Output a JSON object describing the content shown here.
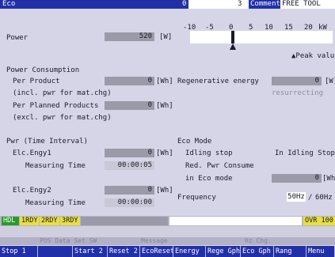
{
  "topbar": {
    "title": "Eco",
    "left_num": "0",
    "right_num": "3",
    "comment_label": "Comment",
    "comment_value": "FREE TOOL"
  },
  "power": {
    "label": "Power",
    "value": "520",
    "unit": "[W]"
  },
  "graph": {
    "ticks": [
      "-10",
      "-5",
      "0",
      "5",
      "10",
      "15",
      "20"
    ],
    "unit": "kW",
    "peak_label": "▲Peak valu"
  },
  "consumption": {
    "title": "Power Consumption",
    "per_product_label": "Per Product",
    "per_product_value": "0",
    "per_product_unit": "[Wh]",
    "per_product_note": "(incl. pwr for mat.chg)",
    "per_planned_label": "Per Planned Products",
    "per_planned_value": "0",
    "per_planned_unit": "[Wh]",
    "per_planned_note": "(excl. pwr for mat.chg)",
    "regen_label": "Regenerative energy",
    "regen_value": "0",
    "regen_unit": "[W]",
    "regen_status": "resurrecting"
  },
  "time_interval": {
    "title": "Pwr (Time Interval)",
    "elc1_label": "Elc.Engy1",
    "elc1_value": "0",
    "elc1_unit": "[Wh]",
    "mt1_label": "Measuring Time",
    "mt1_value": "00:00:05",
    "elc2_label": "Elc.Engy2",
    "elc2_value": "0",
    "elc2_unit": "[Wh]",
    "mt2_label": "Measuring Time",
    "mt2_value": "00:00:00"
  },
  "eco_mode": {
    "title": "Eco Mode",
    "idling_label": "Idling stop",
    "idling_value": "In Idling Stop",
    "red_label": "Red. Pwr Consume",
    "in_eco_label": "in Eco mode",
    "in_eco_value": "0",
    "in_eco_unit": "[Wh",
    "freq_label": "Frequency",
    "freq_selected": "50Hz",
    "freq_sep": "/",
    "freq_other": "60Hz"
  },
  "status": {
    "hdl": "HDL",
    "rdy1": "1RDY",
    "rdy2": "2RDY",
    "rdy3": "3RDY",
    "ovr": "OVR 100"
  },
  "labels": {
    "pos_data": "POS Data Set SW",
    "message": "Message",
    "hz_chg": "Hz Chg."
  },
  "softkeys": [
    "Stop 1",
    "",
    "Start 2",
    "Reset 2",
    "EcoReset",
    "Energy G",
    "Rege Gph",
    "Eco Gph",
    "Rang Chg",
    "Menu Sl"
  ],
  "colors": {
    "header_blue": "#2230a8",
    "panel": "#d6d5e8",
    "value_box": "#9a9aa8",
    "rdy_green": "#2a9a2a",
    "rdy_yellow": "#e8e040"
  }
}
